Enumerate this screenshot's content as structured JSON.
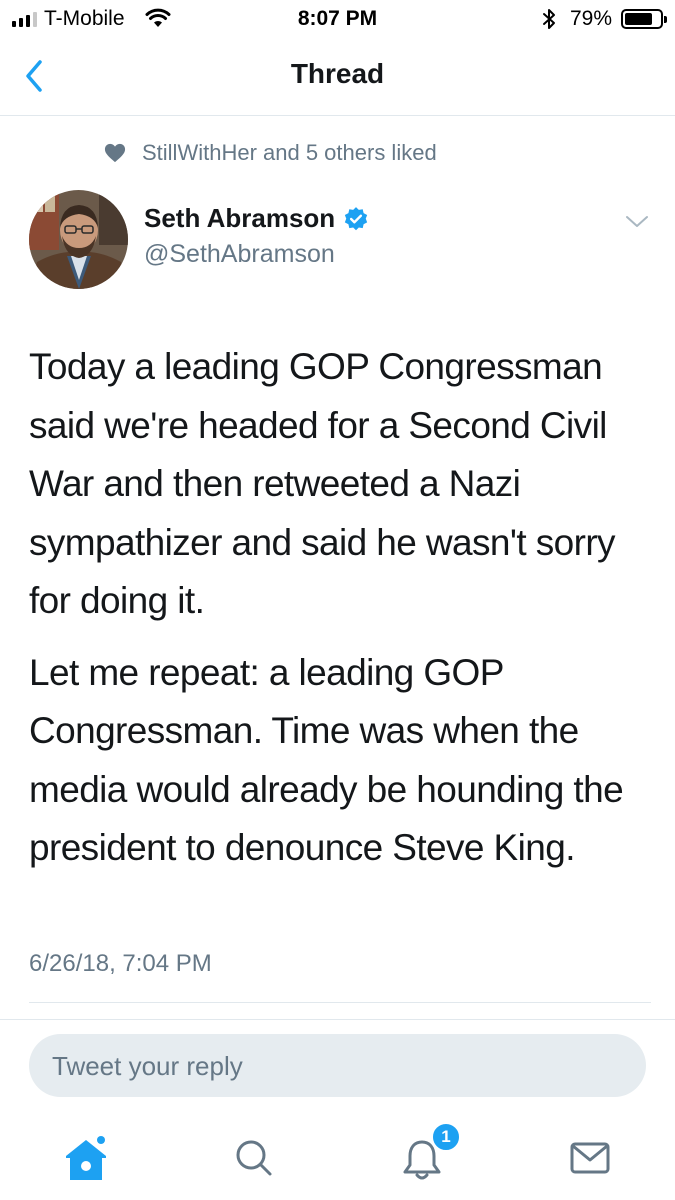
{
  "status_bar": {
    "carrier": "T-Mobile",
    "time": "8:07 PM",
    "battery_percent": "79%",
    "battery_level": 0.79,
    "signal_bars": 3,
    "icons": [
      "signal-icon",
      "wifi-icon",
      "bluetooth-icon",
      "battery-icon"
    ]
  },
  "nav": {
    "title": "Thread",
    "back_icon": "chevron-left-icon"
  },
  "social_context": {
    "icon": "heart-icon",
    "text": "StillWithHer and 5 others liked"
  },
  "tweet": {
    "author_name": "Seth Abramson",
    "author_handle": "@SethAbramson",
    "verified": true,
    "paragraphs": [
      "Today a leading GOP Congressman said we're headed for a Second Civil War and then retweeted a Nazi sympathizer and said he wasn't sorry for doing it.",
      "Let me repeat: a leading GOP Congressman. Time was when the media would already be hounding the president to denounce Steve King."
    ],
    "timestamp": "6/26/18, 7:04 PM"
  },
  "reply": {
    "placeholder": "Tweet your reply"
  },
  "tabbar": {
    "tabs": [
      "home-icon",
      "search-icon",
      "notifications-icon",
      "messages-icon"
    ],
    "notifications_badge": "1"
  },
  "colors": {
    "accent": "#1da1f2",
    "text_primary": "#14171a",
    "text_secondary": "#657786",
    "divider": "#e1e8ed",
    "reply_bg": "#e6ecf0"
  }
}
